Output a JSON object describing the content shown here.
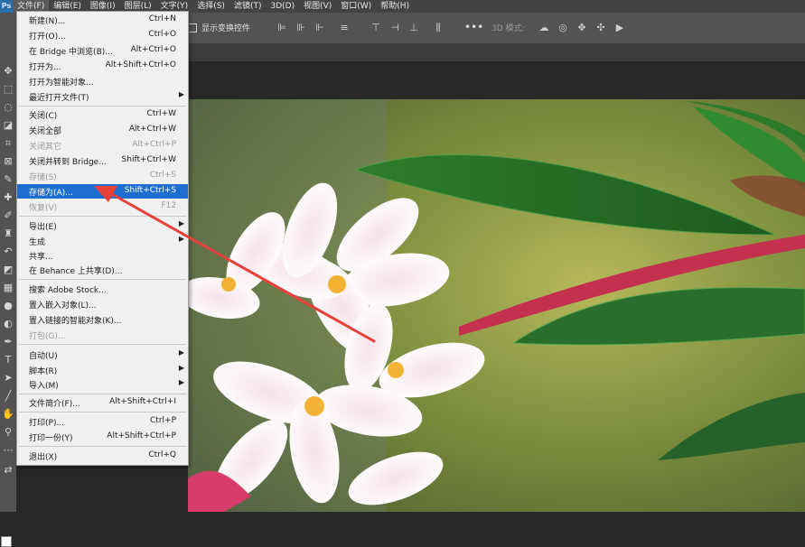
{
  "app": {
    "logo": "Ps"
  },
  "menubar": {
    "items": [
      "文件(F)",
      "编辑(E)",
      "图像(I)",
      "图层(L)",
      "文字(Y)",
      "选择(S)",
      "滤镜(T)",
      "3D(D)",
      "视图(V)",
      "窗口(W)",
      "帮助(H)"
    ]
  },
  "options": {
    "transform_label": "显示变换控件",
    "more": "•••",
    "mode3d_label": "3D 模式:"
  },
  "file_menu": {
    "items": [
      {
        "label": "新建(N)...",
        "shortcut": "Ctrl+N"
      },
      {
        "label": "打开(O)...",
        "shortcut": "Ctrl+O"
      },
      {
        "label": "在 Bridge 中浏览(B)...",
        "shortcut": "Alt+Ctrl+O"
      },
      {
        "label": "打开为...",
        "shortcut": "Alt+Shift+Ctrl+O"
      },
      {
        "label": "打开为智能对象...",
        "shortcut": ""
      },
      {
        "label": "最近打开文件(T)",
        "shortcut": ""
      },
      {
        "label": "关闭(C)",
        "shortcut": "Ctrl+W"
      },
      {
        "label": "关闭全部",
        "shortcut": "Alt+Ctrl+W"
      },
      {
        "label": "关闭其它",
        "shortcut": "Alt+Ctrl+P"
      },
      {
        "label": "关闭并转到 Bridge...",
        "shortcut": "Shift+Ctrl+W"
      },
      {
        "label": "存储(S)",
        "shortcut": "Ctrl+S"
      },
      {
        "label": "存储为(A)...",
        "shortcut": "Shift+Ctrl+S"
      },
      {
        "label": "恢复(V)",
        "shortcut": "F12"
      },
      {
        "label": "导出(E)",
        "shortcut": ""
      },
      {
        "label": "生成",
        "shortcut": ""
      },
      {
        "label": "共享...",
        "shortcut": ""
      },
      {
        "label": "在 Behance 上共享(D)...",
        "shortcut": ""
      },
      {
        "label": "搜索 Adobe Stock...",
        "shortcut": ""
      },
      {
        "label": "置入嵌入对象(L)...",
        "shortcut": ""
      },
      {
        "label": "置入链接的智能对象(K)...",
        "shortcut": ""
      },
      {
        "label": "打包(G)...",
        "shortcut": ""
      },
      {
        "label": "自动(U)",
        "shortcut": ""
      },
      {
        "label": "脚本(R)",
        "shortcut": ""
      },
      {
        "label": "导入(M)",
        "shortcut": ""
      },
      {
        "label": "文件简介(F)...",
        "shortcut": "Alt+Shift+Ctrl+I"
      },
      {
        "label": "打印(P)...",
        "shortcut": "Ctrl+P"
      },
      {
        "label": "打印一份(Y)",
        "shortcut": "Alt+Shift+Ctrl+P"
      },
      {
        "label": "退出(X)",
        "shortcut": "Ctrl+Q"
      }
    ],
    "highlighted": "存储为(A)..."
  },
  "colors": {
    "highlight": "#1e6fd1",
    "annotation_arrow": "#e8403a"
  }
}
